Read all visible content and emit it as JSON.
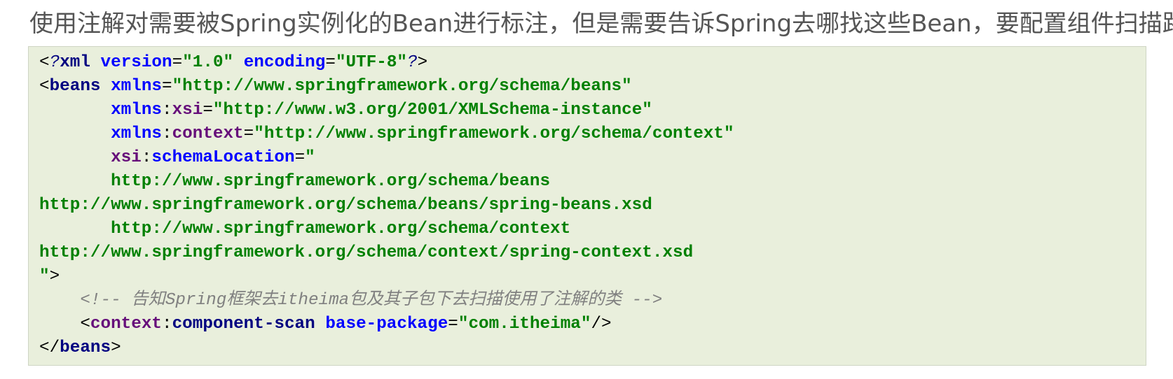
{
  "heading": "使用注解对需要被Spring实例化的Bean进行标注，但是需要告诉Spring去哪找这些Bean，要配置组件扫描路径",
  "code": {
    "language": "xml",
    "lines": [
      [
        {
          "t": "<",
          "c": "punct"
        },
        {
          "t": "?",
          "c": "pi"
        },
        {
          "t": "xml",
          "c": "tag"
        },
        {
          "t": " ",
          "c": "punct"
        },
        {
          "t": "version",
          "c": "attr"
        },
        {
          "t": "=",
          "c": "punct"
        },
        {
          "t": "\"1.0\"",
          "c": "str"
        },
        {
          "t": " ",
          "c": "punct"
        },
        {
          "t": "encoding",
          "c": "attr"
        },
        {
          "t": "=",
          "c": "punct"
        },
        {
          "t": "\"UTF-8\"",
          "c": "str"
        },
        {
          "t": "?",
          "c": "pi"
        },
        {
          "t": ">",
          "c": "punct"
        }
      ],
      [
        {
          "t": "<",
          "c": "punct"
        },
        {
          "t": "beans",
          "c": "tag"
        },
        {
          "t": " ",
          "c": "punct"
        },
        {
          "t": "xmlns",
          "c": "attr"
        },
        {
          "t": "=",
          "c": "punct"
        },
        {
          "t": "\"http://www.springframework.org/schema/beans\"",
          "c": "str"
        }
      ],
      [
        {
          "t": "       ",
          "c": "punct"
        },
        {
          "t": "xmlns",
          "c": "attr"
        },
        {
          "t": ":",
          "c": "punct"
        },
        {
          "t": "xsi",
          "c": "ns"
        },
        {
          "t": "=",
          "c": "punct"
        },
        {
          "t": "\"http://www.w3.org/2001/XMLSchema-instance\"",
          "c": "str"
        }
      ],
      [
        {
          "t": "       ",
          "c": "punct"
        },
        {
          "t": "xmlns",
          "c": "attr"
        },
        {
          "t": ":",
          "c": "punct"
        },
        {
          "t": "context",
          "c": "ns"
        },
        {
          "t": "=",
          "c": "punct"
        },
        {
          "t": "\"http://www.springframework.org/schema/context\"",
          "c": "str"
        }
      ],
      [
        {
          "t": "       ",
          "c": "punct"
        },
        {
          "t": "xsi",
          "c": "ns"
        },
        {
          "t": ":",
          "c": "punct"
        },
        {
          "t": "schemaLocation",
          "c": "attr"
        },
        {
          "t": "=",
          "c": "punct"
        },
        {
          "t": "\"",
          "c": "str"
        }
      ],
      [
        {
          "t": "       http://www.springframework.org/schema/beans",
          "c": "str"
        }
      ],
      [
        {
          "t": "http://www.springframework.org/schema/beans/spring-beans.xsd",
          "c": "str"
        }
      ],
      [
        {
          "t": "       http://www.springframework.org/schema/context",
          "c": "str"
        }
      ],
      [
        {
          "t": "http://www.springframework.org/schema/context/spring-context.xsd",
          "c": "str"
        }
      ],
      [
        {
          "t": "\"",
          "c": "str"
        },
        {
          "t": ">",
          "c": "punct"
        }
      ],
      [
        {
          "t": "    ",
          "c": "punct"
        },
        {
          "t": "<!-- 告知Spring框架去itheima包及其子包下去扫描使用了注解的类 -->",
          "c": "cmt"
        }
      ],
      [
        {
          "t": "    ",
          "c": "punct"
        },
        {
          "t": "<",
          "c": "punct"
        },
        {
          "t": "context",
          "c": "ns"
        },
        {
          "t": ":",
          "c": "punct"
        },
        {
          "t": "component-scan",
          "c": "tag"
        },
        {
          "t": " ",
          "c": "punct"
        },
        {
          "t": "base-package",
          "c": "attr"
        },
        {
          "t": "=",
          "c": "punct"
        },
        {
          "t": "\"com.itheima\"",
          "c": "str"
        },
        {
          "t": "/>",
          "c": "punct"
        }
      ],
      [
        {
          "t": "</",
          "c": "punct"
        },
        {
          "t": "beans",
          "c": "tag"
        },
        {
          "t": ">",
          "c": "punct"
        }
      ]
    ]
  }
}
